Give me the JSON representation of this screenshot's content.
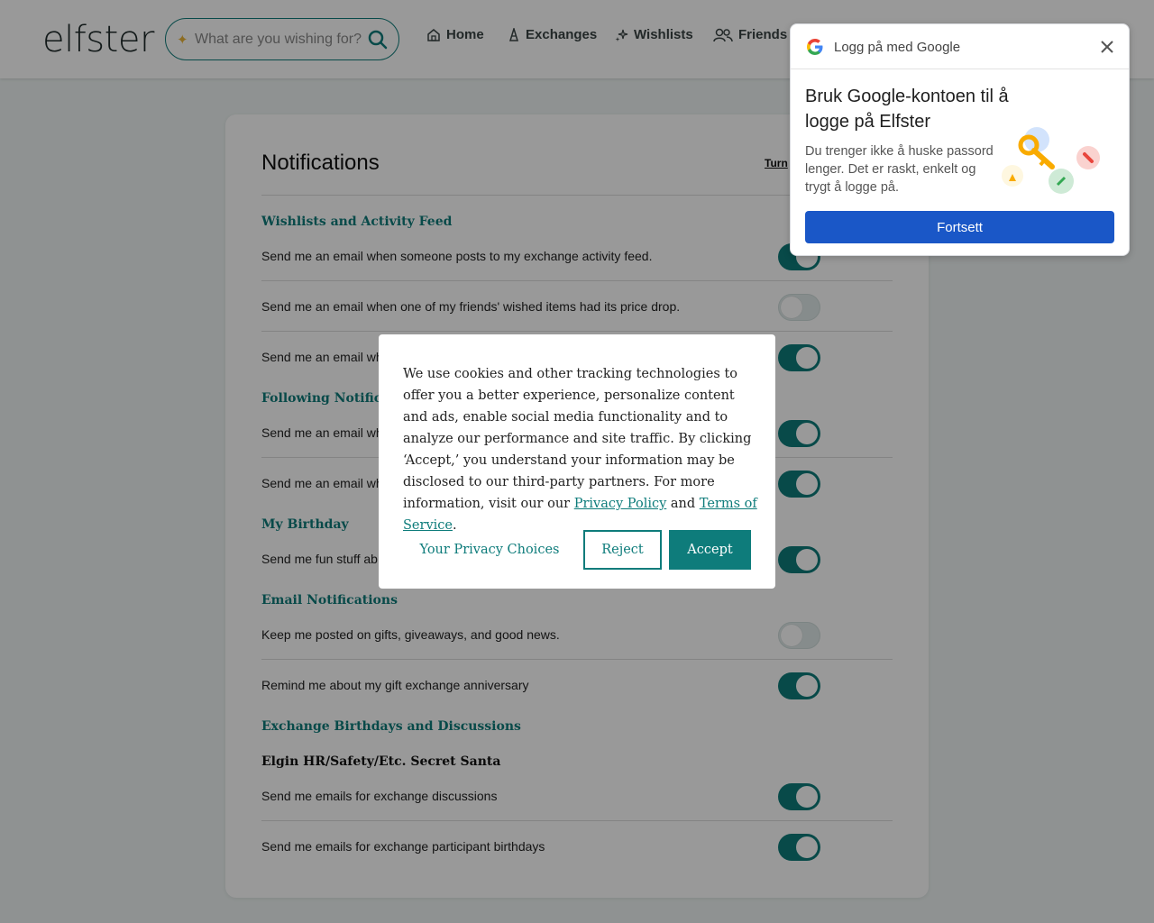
{
  "header": {
    "logo": "elfster",
    "search_placeholder": "What are you wishing for?",
    "nav": {
      "home": "Home",
      "exchanges": "Exchanges",
      "wishlists": "Wishlists",
      "friends": "Friends"
    }
  },
  "notifications": {
    "title": "Notifications",
    "turn_link": "Turn",
    "sections": {
      "wishlists": {
        "title": "Wishlists and Activity Feed",
        "items": [
          {
            "label": "Send me an email when someone posts to my exchange activity feed.",
            "enabled": true
          },
          {
            "label": "Send me an email when one of my friends' wished items had its price drop.",
            "enabled": false
          },
          {
            "label": "Send me an email wh",
            "enabled": true
          }
        ]
      },
      "following": {
        "title": "Following Notificati",
        "items": [
          {
            "label": "Send me an email wh",
            "enabled": true
          },
          {
            "label": "Send me an email wh",
            "enabled": true
          }
        ]
      },
      "birthday": {
        "title": "My Birthday",
        "items": [
          {
            "label": "Send me fun stuff ab",
            "enabled": true
          }
        ]
      },
      "email": {
        "title": "Email Notifications",
        "items": [
          {
            "label": "Keep me posted on gifts, giveaways, and good news.",
            "enabled": false
          },
          {
            "label": "Remind me about my gift exchange anniversary",
            "enabled": true
          }
        ]
      },
      "exchange": {
        "title": "Exchange Birthdays and Discussions",
        "group_name": "Elgin HR/Safety/Etc. Secret Santa",
        "items": [
          {
            "label": "Send me emails for exchange discussions",
            "enabled": true
          },
          {
            "label": "Send me emails for exchange participant birthdays",
            "enabled": true
          }
        ]
      }
    }
  },
  "cookie_dialog": {
    "text_before": "We use cookies and other tracking technologies to offer you a better experience, personalize content and ads, enable social media functionality and to analyze our performance and site traffic. By clicking ‘Accept,’ you understand your information may be disclosed to our third-party partners. For more information, visit our our",
    "privacy_link": "Privacy Policy",
    "and": "and",
    "terms_link": "Terms of Service",
    "period": ".",
    "choices_button": "Your Privacy Choices",
    "reject_button": "Reject",
    "accept_button": "Accept"
  },
  "google_popup": {
    "header": "Logg på med Google",
    "title": "Bruk Google-kontoen til å logge på Elfster",
    "body": "Du trenger ikke å huske passord lenger. Det er raskt, enkelt og trygt å logge på.",
    "button": "Fortsett"
  },
  "colors": {
    "accent": "#0e7c7b",
    "google_button": "#1a57c7",
    "overlay": "rgba(0,0,0,0.4)"
  }
}
